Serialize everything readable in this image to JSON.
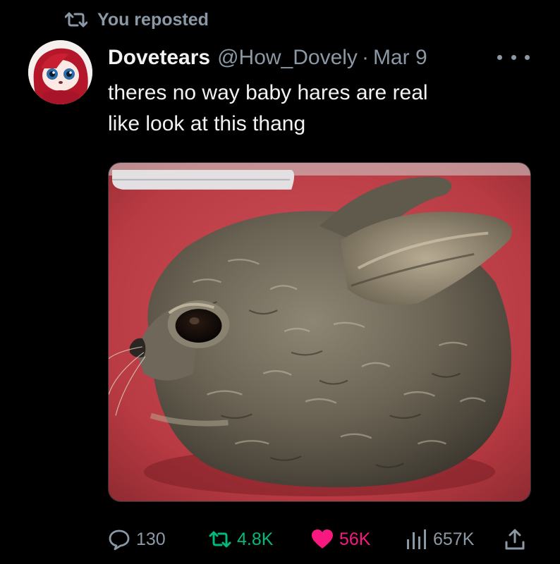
{
  "repost_banner": {
    "text": "You reposted",
    "icon": "repost-icon"
  },
  "post": {
    "author_name": "Dovetears",
    "handle": "@How_Dovely",
    "separator": "·",
    "date": "Mar 9",
    "text_lines": [
      "theres no way baby hares are real",
      "like look at this thang"
    ],
    "media_icon": "baby-hare-photo"
  },
  "actions": {
    "replies": "130",
    "reposts": "4.8K",
    "likes": "56K",
    "views": "657K"
  },
  "colors": {
    "background": "#000000",
    "muted": "#8b98a5",
    "repost_active": "#00ba7c",
    "like_active": "#f91880"
  }
}
